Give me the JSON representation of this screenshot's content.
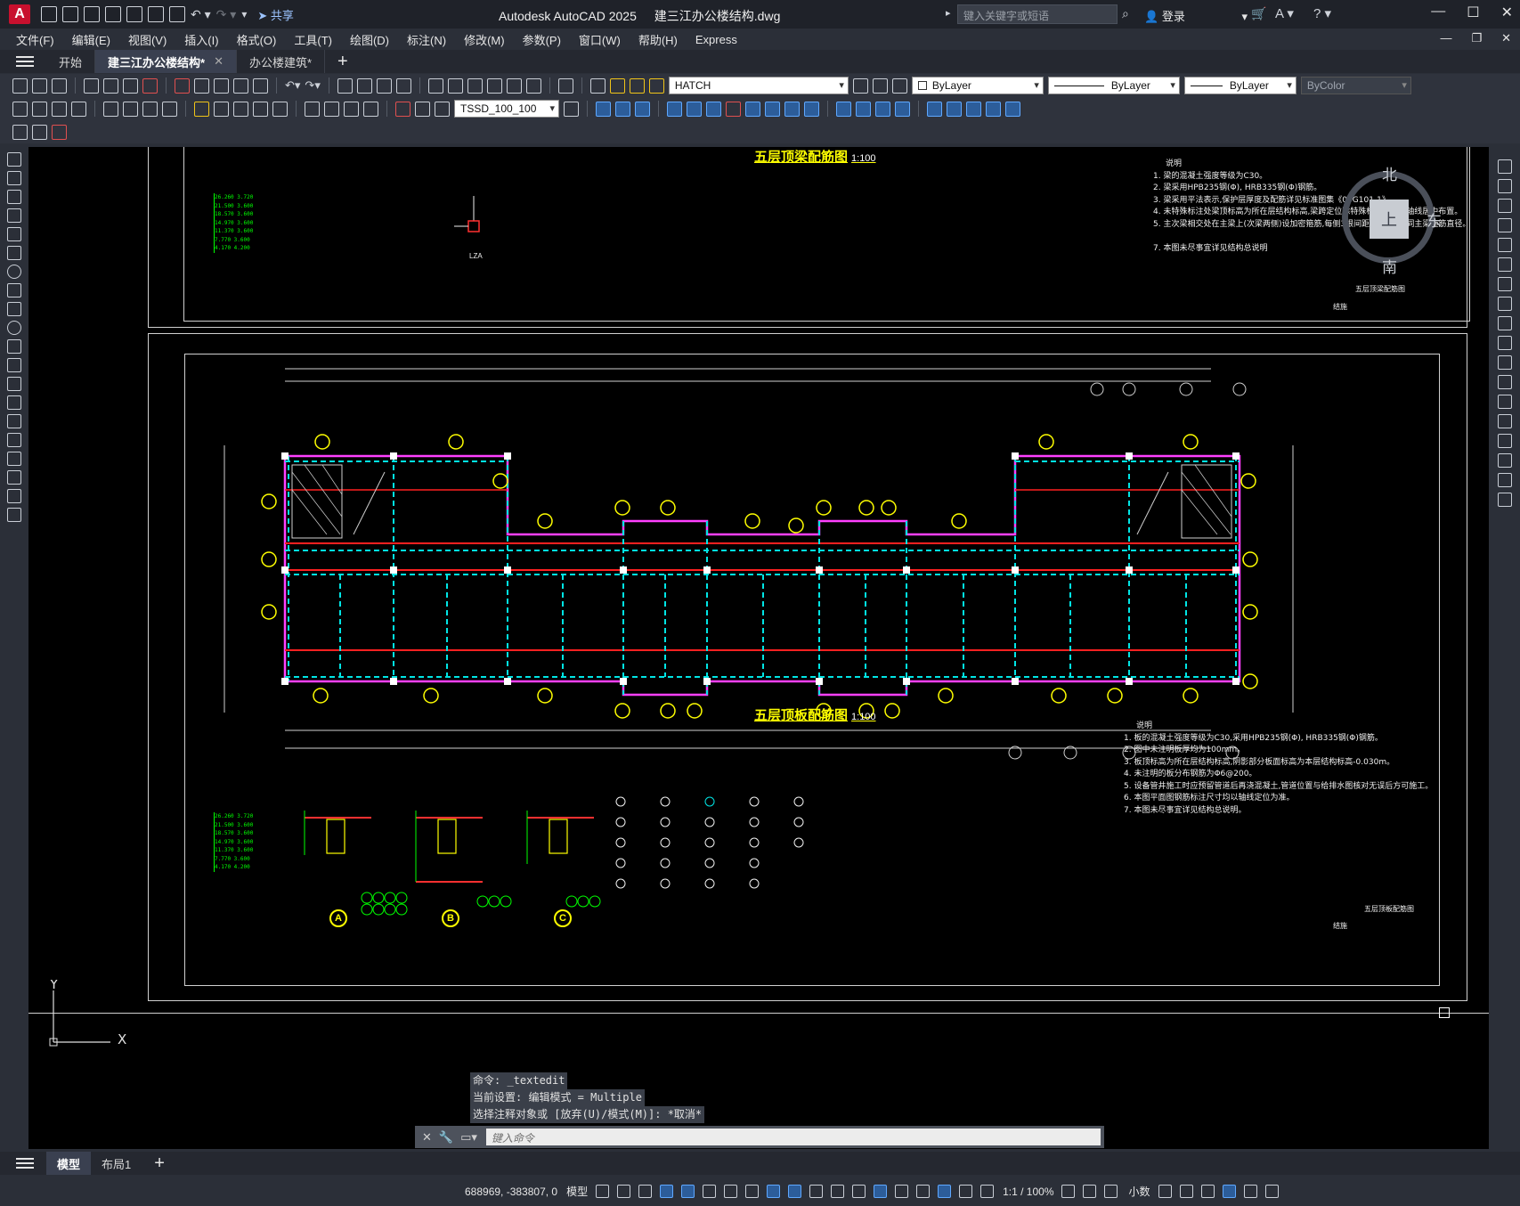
{
  "app": {
    "logo": "A",
    "title": "Autodesk AutoCAD 2025",
    "filename": "建三江办公楼结构.dwg",
    "share": "共享",
    "search_placeholder": "键入关键字或短语",
    "login": "登录"
  },
  "menu": [
    "文件(F)",
    "编辑(E)",
    "视图(V)",
    "插入(I)",
    "格式(O)",
    "工具(T)",
    "绘图(D)",
    "标注(N)",
    "修改(M)",
    "参数(P)",
    "窗口(W)",
    "帮助(H)",
    "Express"
  ],
  "tabs": {
    "start": "开始",
    "doc1": "建三江办公楼结构*",
    "doc2": "办公楼建筑*"
  },
  "toolbar": {
    "layer": "HATCH",
    "color": "ByLayer",
    "linetype": "ByLayer",
    "lineweight": "ByLayer",
    "plotstyle": "ByColor",
    "dimstyle": "TSSD_100_100"
  },
  "compass": {
    "north": "北",
    "south": "南",
    "east": "东",
    "top": "上"
  },
  "drawing": {
    "title_top": "五层顶梁配筋图",
    "title_bottom": "五层顶板配筋图",
    "scale": "1:100",
    "notes_top_heading": "说明",
    "notes_top": [
      "1. 梁的混凝土强度等级为C30。",
      "2. 梁采用HPB235钢(Φ), HRB335钢(Φ)钢筋。",
      "3. 梁采用平法表示,保护层厚度及配筋详见标准图集《03G101-1》",
      "4. 未特殊标注处梁顶标高为所在层结构标高,梁跨定位除特殊标注外均以轴线居中布置。",
      "5. 主次梁相交处在主梁上(次梁两侧)设加密箍筋,每侧3根间距@50,直径同主梁箍筋直径。",
      "7. 本图未尽事宜详见结构总说明"
    ],
    "notes_bottom_heading": "说明",
    "notes_bottom": [
      "1. 板的混凝土强度等级为C30,采用HPB235钢(Φ), HRB335钢(Φ)钢筋。",
      "2. 图中未注明板厚均为100mm。",
      "3. 板顶标高为所在层结构标高,阴影部分板面标高为本层结构标高-0.030m。",
      "4. 未注明的板分布钢筋为Φ6@200。",
      "5. 设备管井施工时应预留管道后再浇混凝土,管道位置与给排水图核对无误后方可施工。",
      "6. 本图平面图钢筋标注尺寸均以轴线定位为准。",
      "7. 本图未尽事宜详见结构总说明。"
    ],
    "sheet_top": "五层顶梁配筋图",
    "sheet_bottom": "五层顶板配筋图",
    "sheet_no_label": "结施",
    "detail_label": "LZA",
    "detail_markers": [
      "A",
      "B",
      "C"
    ]
  },
  "command": {
    "history": [
      "命令: _textedit",
      "当前设置: 编辑模式 = Multiple",
      "选择注释对象或 [放弃(U)/模式(M)]: *取消*"
    ],
    "placeholder": "键入命令"
  },
  "layouts": {
    "model": "模型",
    "layout1": "布局1"
  },
  "status": {
    "coords": "688969, -383807, 0",
    "model": "模型",
    "scale": "1:1 / 100%",
    "units": "小数"
  }
}
